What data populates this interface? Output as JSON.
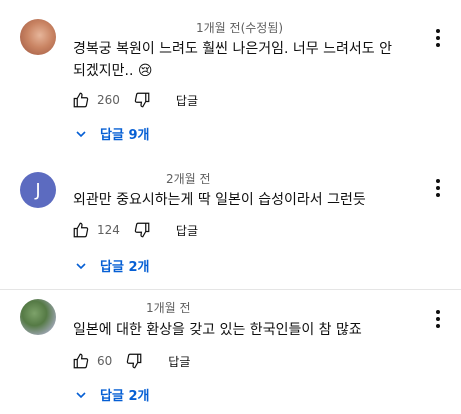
{
  "comments": [
    {
      "avatar_letter": "",
      "timestamp": "1개월 전(수정됨)",
      "text": "경복궁 복원이 느려도 훨씬 나은거임. 너무 느려서도 안 되겠지만.. 😢",
      "likes": "260",
      "reply_label": "답글",
      "replies_label": "답글 9개"
    },
    {
      "avatar_letter": "J",
      "timestamp": "2개월 전",
      "text": "외관만 중요시하는게 딱 일본이 습성이라서 그런듯",
      "likes": "124",
      "reply_label": "답글",
      "replies_label": "답글 2개"
    },
    {
      "avatar_letter": "",
      "timestamp": "1개월 전",
      "text": "일본에 대한 환상을 갖고 있는 한국인들이 참 많죠",
      "likes": "60",
      "reply_label": "답글",
      "replies_label": "답글 2개"
    }
  ],
  "icons": {
    "like": "thumb-up-icon",
    "dislike": "thumb-down-icon",
    "more": "more-vert-icon",
    "expand": "chevron-down-icon"
  },
  "colors": {
    "link": "#065fd4",
    "meta": "#606060",
    "avatar_j": "#5c6bc0"
  }
}
